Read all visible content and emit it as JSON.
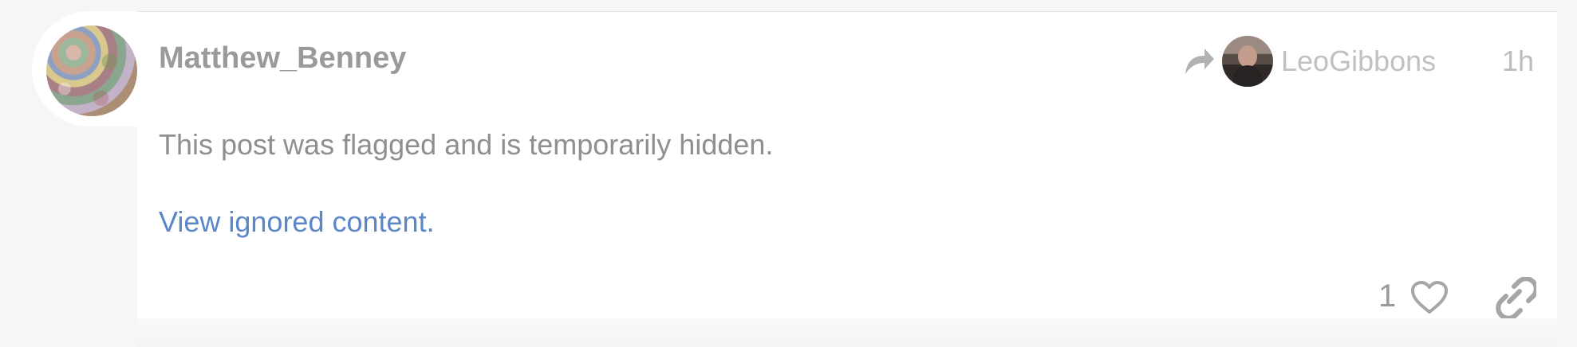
{
  "post": {
    "author": "Matthew_Benney",
    "reply_to": "LeoGibbons",
    "time": "1h",
    "notice": "This post was flagged and is temporarily hidden.",
    "view_ignored": "View ignored content.",
    "likes": "1"
  },
  "icons": {
    "avatar": "user-avatar-icon",
    "reply": "reply-arrow-icon",
    "heart": "heart-icon",
    "link": "link-icon"
  },
  "colors": {
    "text_muted": "#8f8f8f",
    "meta": "#bdbdbd",
    "link": "#5b87c8",
    "icon": "#a9a9a9"
  }
}
